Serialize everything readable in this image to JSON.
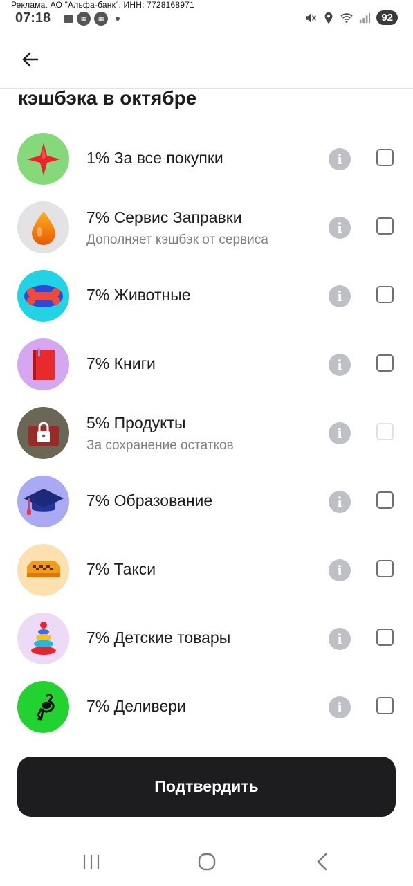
{
  "ad_text": "Реклама. АО \"Альфа-банк\". ИНН: 7728168971",
  "status_bar": {
    "time": "07:18",
    "battery": "92",
    "icons": [
      "notification-icon",
      "app-icon",
      "app-icon",
      "dot-icon",
      "mute-icon",
      "location-icon",
      "wifi-icon",
      "signal-icon"
    ]
  },
  "header": {
    "back_icon": "arrow-left-icon"
  },
  "section_title": "кэшбэка в октябре",
  "categories": [
    {
      "title": "1% За все покупки",
      "subtitle": "",
      "icon": "star-icon",
      "bg": "#86d97a",
      "enabled": true
    },
    {
      "title": "7% Сервис Заправки",
      "subtitle": "Дополняет кэшбэк от сервиса",
      "icon": "fuel-drop-icon",
      "bg": "#e3e3e6",
      "enabled": true
    },
    {
      "title": "7% Животные",
      "subtitle": "",
      "icon": "bone-icon",
      "bg": "#22d3e6",
      "enabled": true
    },
    {
      "title": "7% Книги",
      "subtitle": "",
      "icon": "book-icon",
      "bg": "#d5a6f2",
      "enabled": true
    },
    {
      "title": "5% Продукты",
      "subtitle": "За сохранение остатков",
      "icon": "lock-icon",
      "bg": "#6b6756",
      "enabled": false
    },
    {
      "title": "7% Образование",
      "subtitle": "",
      "icon": "graduation-cap-icon",
      "bg": "#a9a9f4",
      "enabled": true
    },
    {
      "title": "7% Такси",
      "subtitle": "",
      "icon": "taxi-icon",
      "bg": "#fce0b0",
      "enabled": true
    },
    {
      "title": "7% Детские товары",
      "subtitle": "",
      "icon": "toy-pyramid-icon",
      "bg": "#ecdaf7",
      "enabled": true
    },
    {
      "title": "7% Деливери",
      "subtitle": "",
      "icon": "ostrich-icon",
      "bg": "#22d230",
      "enabled": true
    }
  ],
  "confirm_button": "Подтвердить",
  "nav_bar": {
    "icons": [
      "recent-apps-icon",
      "home-icon",
      "back-nav-icon"
    ]
  },
  "colors": {
    "primary_button": "#1d1d20",
    "info_icon": "#bfc0c5",
    "subtitle": "#7f7f85"
  }
}
